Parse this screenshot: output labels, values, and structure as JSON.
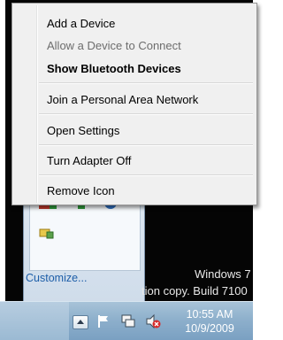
{
  "context_menu": {
    "items": [
      {
        "label": "Add a Device"
      },
      {
        "label": "Allow a Device to Connect",
        "state": "disabled"
      },
      {
        "label": "Show Bluetooth Devices",
        "state": "default-bold"
      },
      {
        "label": "Join a Personal Area Network"
      },
      {
        "label": "Open Settings"
      },
      {
        "label": "Turn Adapter Off"
      },
      {
        "label": "Remove Icon"
      }
    ]
  },
  "notification_overflow": {
    "customize_link": "Customize..."
  },
  "desktop": {
    "watermark_line1": "Windows 7",
    "watermark_line2": "tion copy. Build 7100"
  },
  "taskbar": {
    "clock_time": "10:55 AM",
    "clock_date": "10/9/2009",
    "tray_icons": [
      "show-hidden-icons-button",
      "action-center-flag-icon",
      "network-icon",
      "volume-muted-icon"
    ]
  },
  "colors": {
    "menu_background": "#f0f0f0",
    "taskbar": "#8eb0cc",
    "link": "#1d5ea8"
  }
}
